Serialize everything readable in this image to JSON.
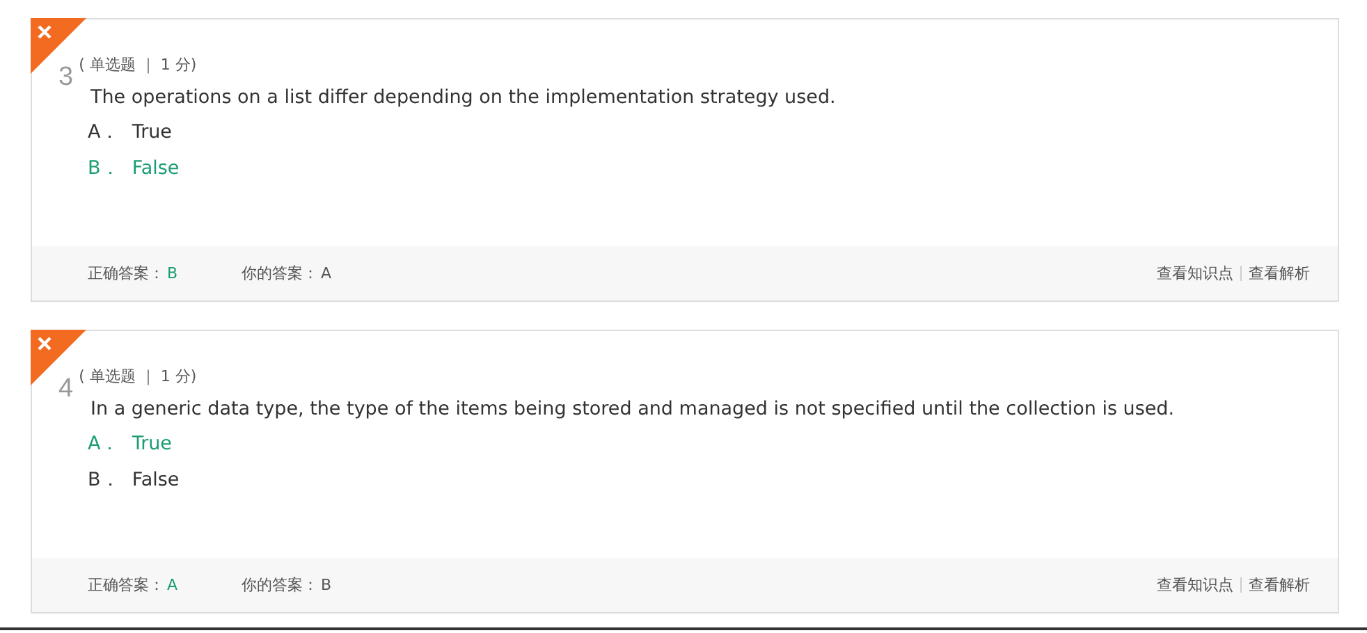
{
  "questions": [
    {
      "wrong": true,
      "number": "3",
      "meta": "( 单选题 ｜ 1 分)",
      "text": "The operations on a list differ depending on the implementation strategy used.",
      "options": [
        {
          "letter": "A．",
          "text": "True",
          "correct": false
        },
        {
          "letter": "B．",
          "text": "False",
          "correct": true
        }
      ],
      "correct_label": "正确答案：",
      "correct_answer": "B",
      "your_label": "你的答案：",
      "your_answer": "A",
      "links": [
        "查看知识点",
        "查看解析"
      ]
    },
    {
      "wrong": true,
      "number": "4",
      "meta": "( 单选题 ｜ 1 分)",
      "text": "In a generic data type, the type of the items being stored and managed is not specified until the collection is used.",
      "options": [
        {
          "letter": "A．",
          "text": "True",
          "correct": true
        },
        {
          "letter": "B．",
          "text": "False",
          "correct": false
        }
      ],
      "correct_label": "正确答案：",
      "correct_answer": "A",
      "your_label": "你的答案：",
      "your_answer": "B",
      "links": [
        "查看知识点",
        "查看解析"
      ]
    }
  ]
}
